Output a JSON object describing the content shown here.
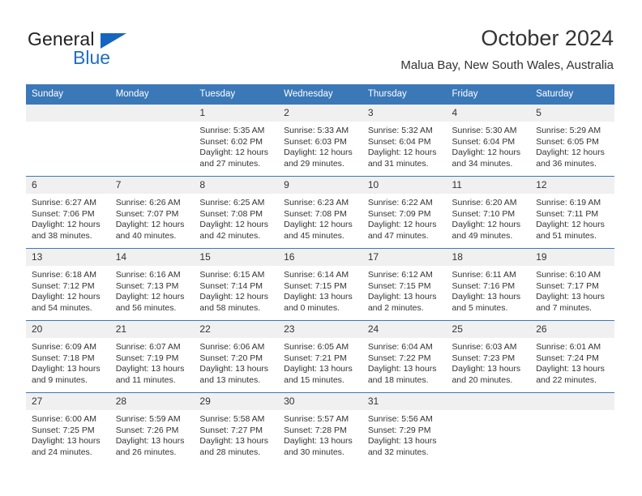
{
  "brand": {
    "name_part1": "General",
    "name_part2": "Blue"
  },
  "header": {
    "title": "October 2024",
    "location": "Malua Bay, New South Wales, Australia"
  },
  "calendar": {
    "weekday_headers": [
      "Sunday",
      "Monday",
      "Tuesday",
      "Wednesday",
      "Thursday",
      "Friday",
      "Saturday"
    ],
    "colors": {
      "header_bg": "#3b78b8",
      "daynum_bg": "#f0f0f0",
      "row_border": "#3b78b8",
      "text": "#333333",
      "brand_blue": "#1f6fc4"
    },
    "weeks": [
      [
        {
          "day": "",
          "lines": []
        },
        {
          "day": "",
          "lines": []
        },
        {
          "day": "1",
          "lines": [
            "Sunrise: 5:35 AM",
            "Sunset: 6:02 PM",
            "Daylight: 12 hours",
            "and 27 minutes."
          ]
        },
        {
          "day": "2",
          "lines": [
            "Sunrise: 5:33 AM",
            "Sunset: 6:03 PM",
            "Daylight: 12 hours",
            "and 29 minutes."
          ]
        },
        {
          "day": "3",
          "lines": [
            "Sunrise: 5:32 AM",
            "Sunset: 6:04 PM",
            "Daylight: 12 hours",
            "and 31 minutes."
          ]
        },
        {
          "day": "4",
          "lines": [
            "Sunrise: 5:30 AM",
            "Sunset: 6:04 PM",
            "Daylight: 12 hours",
            "and 34 minutes."
          ]
        },
        {
          "day": "5",
          "lines": [
            "Sunrise: 5:29 AM",
            "Sunset: 6:05 PM",
            "Daylight: 12 hours",
            "and 36 minutes."
          ]
        }
      ],
      [
        {
          "day": "6",
          "lines": [
            "Sunrise: 6:27 AM",
            "Sunset: 7:06 PM",
            "Daylight: 12 hours",
            "and 38 minutes."
          ]
        },
        {
          "day": "7",
          "lines": [
            "Sunrise: 6:26 AM",
            "Sunset: 7:07 PM",
            "Daylight: 12 hours",
            "and 40 minutes."
          ]
        },
        {
          "day": "8",
          "lines": [
            "Sunrise: 6:25 AM",
            "Sunset: 7:08 PM",
            "Daylight: 12 hours",
            "and 42 minutes."
          ]
        },
        {
          "day": "9",
          "lines": [
            "Sunrise: 6:23 AM",
            "Sunset: 7:08 PM",
            "Daylight: 12 hours",
            "and 45 minutes."
          ]
        },
        {
          "day": "10",
          "lines": [
            "Sunrise: 6:22 AM",
            "Sunset: 7:09 PM",
            "Daylight: 12 hours",
            "and 47 minutes."
          ]
        },
        {
          "day": "11",
          "lines": [
            "Sunrise: 6:20 AM",
            "Sunset: 7:10 PM",
            "Daylight: 12 hours",
            "and 49 minutes."
          ]
        },
        {
          "day": "12",
          "lines": [
            "Sunrise: 6:19 AM",
            "Sunset: 7:11 PM",
            "Daylight: 12 hours",
            "and 51 minutes."
          ]
        }
      ],
      [
        {
          "day": "13",
          "lines": [
            "Sunrise: 6:18 AM",
            "Sunset: 7:12 PM",
            "Daylight: 12 hours",
            "and 54 minutes."
          ]
        },
        {
          "day": "14",
          "lines": [
            "Sunrise: 6:16 AM",
            "Sunset: 7:13 PM",
            "Daylight: 12 hours",
            "and 56 minutes."
          ]
        },
        {
          "day": "15",
          "lines": [
            "Sunrise: 6:15 AM",
            "Sunset: 7:14 PM",
            "Daylight: 12 hours",
            "and 58 minutes."
          ]
        },
        {
          "day": "16",
          "lines": [
            "Sunrise: 6:14 AM",
            "Sunset: 7:15 PM",
            "Daylight: 13 hours",
            "and 0 minutes."
          ]
        },
        {
          "day": "17",
          "lines": [
            "Sunrise: 6:12 AM",
            "Sunset: 7:15 PM",
            "Daylight: 13 hours",
            "and 2 minutes."
          ]
        },
        {
          "day": "18",
          "lines": [
            "Sunrise: 6:11 AM",
            "Sunset: 7:16 PM",
            "Daylight: 13 hours",
            "and 5 minutes."
          ]
        },
        {
          "day": "19",
          "lines": [
            "Sunrise: 6:10 AM",
            "Sunset: 7:17 PM",
            "Daylight: 13 hours",
            "and 7 minutes."
          ]
        }
      ],
      [
        {
          "day": "20",
          "lines": [
            "Sunrise: 6:09 AM",
            "Sunset: 7:18 PM",
            "Daylight: 13 hours",
            "and 9 minutes."
          ]
        },
        {
          "day": "21",
          "lines": [
            "Sunrise: 6:07 AM",
            "Sunset: 7:19 PM",
            "Daylight: 13 hours",
            "and 11 minutes."
          ]
        },
        {
          "day": "22",
          "lines": [
            "Sunrise: 6:06 AM",
            "Sunset: 7:20 PM",
            "Daylight: 13 hours",
            "and 13 minutes."
          ]
        },
        {
          "day": "23",
          "lines": [
            "Sunrise: 6:05 AM",
            "Sunset: 7:21 PM",
            "Daylight: 13 hours",
            "and 15 minutes."
          ]
        },
        {
          "day": "24",
          "lines": [
            "Sunrise: 6:04 AM",
            "Sunset: 7:22 PM",
            "Daylight: 13 hours",
            "and 18 minutes."
          ]
        },
        {
          "day": "25",
          "lines": [
            "Sunrise: 6:03 AM",
            "Sunset: 7:23 PM",
            "Daylight: 13 hours",
            "and 20 minutes."
          ]
        },
        {
          "day": "26",
          "lines": [
            "Sunrise: 6:01 AM",
            "Sunset: 7:24 PM",
            "Daylight: 13 hours",
            "and 22 minutes."
          ]
        }
      ],
      [
        {
          "day": "27",
          "lines": [
            "Sunrise: 6:00 AM",
            "Sunset: 7:25 PM",
            "Daylight: 13 hours",
            "and 24 minutes."
          ]
        },
        {
          "day": "28",
          "lines": [
            "Sunrise: 5:59 AM",
            "Sunset: 7:26 PM",
            "Daylight: 13 hours",
            "and 26 minutes."
          ]
        },
        {
          "day": "29",
          "lines": [
            "Sunrise: 5:58 AM",
            "Sunset: 7:27 PM",
            "Daylight: 13 hours",
            "and 28 minutes."
          ]
        },
        {
          "day": "30",
          "lines": [
            "Sunrise: 5:57 AM",
            "Sunset: 7:28 PM",
            "Daylight: 13 hours",
            "and 30 minutes."
          ]
        },
        {
          "day": "31",
          "lines": [
            "Sunrise: 5:56 AM",
            "Sunset: 7:29 PM",
            "Daylight: 13 hours",
            "and 32 minutes."
          ]
        },
        {
          "day": "",
          "lines": []
        },
        {
          "day": "",
          "lines": []
        }
      ]
    ]
  }
}
